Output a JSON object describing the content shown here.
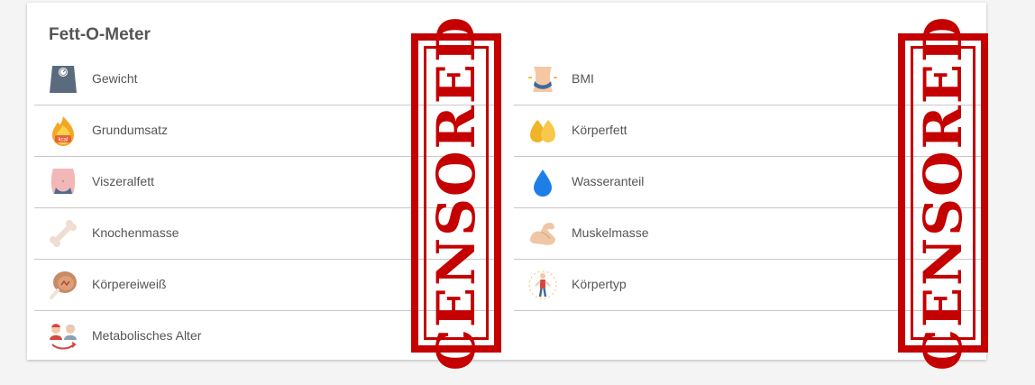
{
  "card": {
    "title": "Fett-O-Meter"
  },
  "left_items": [
    {
      "label": "Gewicht",
      "icon": "scale-icon"
    },
    {
      "label": "Grundumsatz",
      "icon": "kcal-flame-icon"
    },
    {
      "label": "Viszeralfett",
      "icon": "belly-icon"
    },
    {
      "label": "Knochenmasse",
      "icon": "bone-icon"
    },
    {
      "label": "Körpereiweiß",
      "icon": "meat-drumstick-icon"
    },
    {
      "label": "Metabolisches Alter",
      "icon": "age-people-icon"
    }
  ],
  "right_items": [
    {
      "label": "BMI",
      "icon": "waist-icon"
    },
    {
      "label": "Körperfett",
      "icon": "fat-drops-icon"
    },
    {
      "label": "Wasseranteil",
      "icon": "water-drop-icon"
    },
    {
      "label": "Muskelmasse",
      "icon": "muscle-arm-icon"
    },
    {
      "label": "Körpertyp",
      "icon": "body-type-icon"
    }
  ],
  "stamps": [
    {
      "text": "CENSORED"
    },
    {
      "text": "CENSORED"
    }
  ],
  "colors": {
    "stamp": "#c40000",
    "divider": "#c8c8c8",
    "background": "#f4f4f4"
  }
}
